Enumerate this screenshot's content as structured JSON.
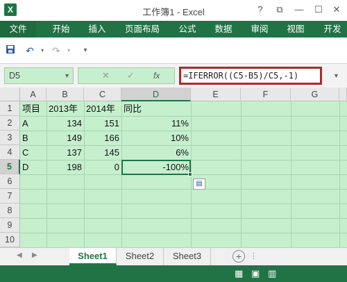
{
  "window": {
    "title": "工作簿1 - Excel",
    "help": "?",
    "restore": "⧉",
    "minimize": "—",
    "maximize": "☐",
    "close": "✕",
    "app_icon": "X"
  },
  "ribbon": {
    "tabs": [
      {
        "label": "文件"
      },
      {
        "label": "开始"
      },
      {
        "label": "插入"
      },
      {
        "label": "页面布局"
      },
      {
        "label": "公式"
      },
      {
        "label": "数据"
      },
      {
        "label": "审阅"
      },
      {
        "label": "视图"
      },
      {
        "label": "开发"
      }
    ]
  },
  "formula_bar": {
    "name_box": "D5",
    "cancel": "✕",
    "enter": "✓",
    "fx": "fx",
    "formula": "=IFERROR((C5-B5)/C5,-1)"
  },
  "sheet": {
    "columns": [
      "A",
      "B",
      "C",
      "D",
      "E",
      "F",
      "G"
    ],
    "rows": [
      "1",
      "2",
      "3",
      "4",
      "5",
      "6",
      "7",
      "8",
      "9",
      "10"
    ],
    "cells": [
      [
        "项目",
        "2013年",
        "2014年",
        "同比"
      ],
      [
        "A",
        "134",
        "151",
        "11%"
      ],
      [
        "B",
        "149",
        "166",
        "10%"
      ],
      [
        "C",
        "137",
        "145",
        "6%"
      ],
      [
        "D",
        "198",
        "0",
        "-100%"
      ]
    ],
    "active_cell": "D5"
  },
  "sheet_tabs": [
    {
      "label": "Sheet1"
    },
    {
      "label": "Sheet2"
    },
    {
      "label": "Sheet3"
    }
  ],
  "colors": {
    "accent": "#217346",
    "selection": "#c6efce",
    "highlight_box": "#b02828"
  }
}
